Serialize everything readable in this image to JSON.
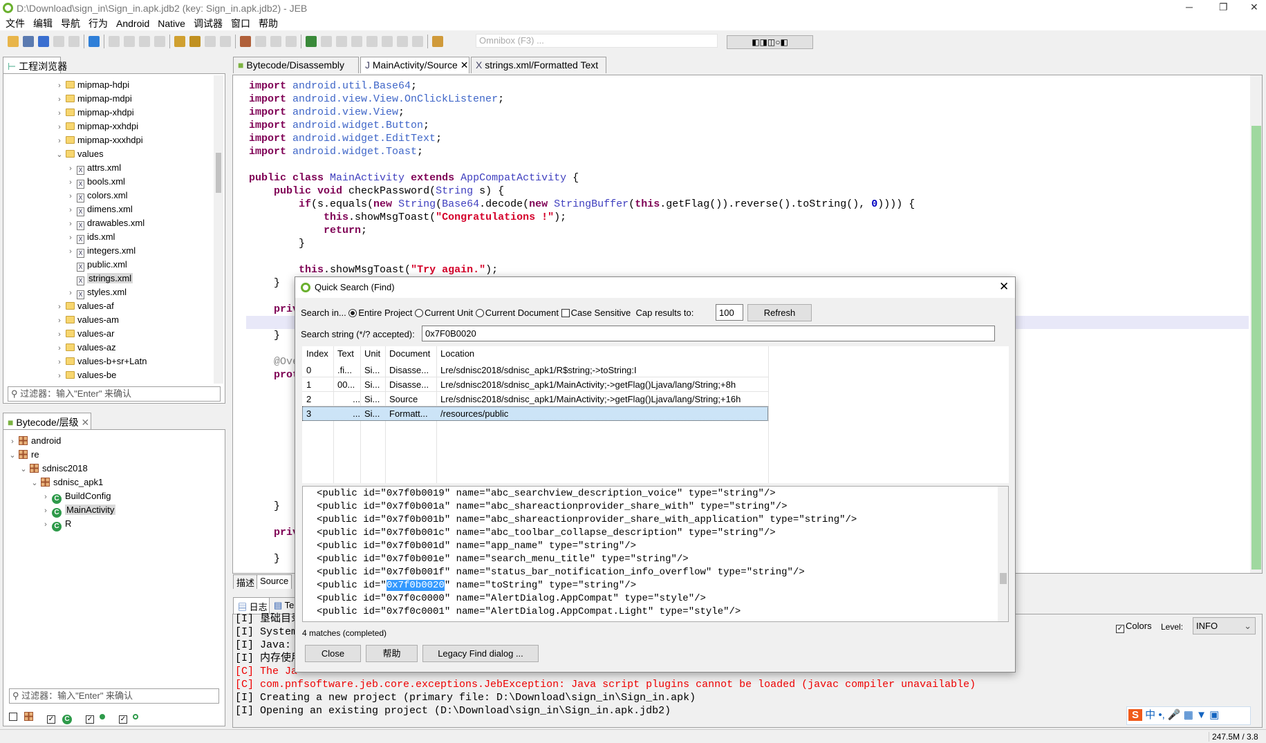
{
  "window": {
    "title": "D:\\Download\\sign_in\\Sign_in.apk.jdb2 (key: Sign_in.apk.jdb2) - JEB"
  },
  "menu": [
    "文件",
    "编辑",
    "导航",
    "行为",
    "Android",
    "Native",
    "调试器",
    "窗口",
    "帮助"
  ],
  "toolbar": {
    "icons": [
      "open-icon",
      "save-icon",
      "wrench-icon",
      "cube-icon",
      "warning-icon",
      "|",
      "globe-icon",
      "|",
      "jump-icon",
      "xref-icon",
      "back-icon",
      "forward-icon",
      "|",
      "decompile-icon",
      "comment-icon",
      "rename-icon",
      "export-icon",
      "|",
      "package-icon",
      "tree-icon",
      "nodes-icon",
      "graph-icon",
      "|",
      "debug-icon",
      "run-icon",
      "pause-icon",
      "stop-icon",
      "step-into-icon",
      "step-over-icon",
      "step-out-icon",
      "run-to-icon",
      "|",
      "plugin-icon"
    ],
    "omnibox_placeholder": "Omnibox (F3) ..."
  },
  "project_explorer": {
    "tab": "工程浏览器",
    "filter_placeholder": "过滤器：输入\"Enter\" 来确认",
    "items": [
      {
        "label": "mipmap-hdpi",
        "level": 0,
        "type": "folder",
        "state": "collapsed"
      },
      {
        "label": "mipmap-mdpi",
        "level": 0,
        "type": "folder",
        "state": "collapsed"
      },
      {
        "label": "mipmap-xhdpi",
        "level": 0,
        "type": "folder",
        "state": "collapsed"
      },
      {
        "label": "mipmap-xxhdpi",
        "level": 0,
        "type": "folder",
        "state": "collapsed"
      },
      {
        "label": "mipmap-xxxhdpi",
        "level": 0,
        "type": "folder",
        "state": "collapsed"
      },
      {
        "label": "values",
        "level": 0,
        "type": "folder",
        "state": "expanded"
      },
      {
        "label": "attrs.xml",
        "level": 1,
        "type": "xml",
        "state": "collapsed"
      },
      {
        "label": "bools.xml",
        "level": 1,
        "type": "xml",
        "state": "collapsed"
      },
      {
        "label": "colors.xml",
        "level": 1,
        "type": "xml",
        "state": "collapsed"
      },
      {
        "label": "dimens.xml",
        "level": 1,
        "type": "xml",
        "state": "collapsed"
      },
      {
        "label": "drawables.xml",
        "level": 1,
        "type": "xml",
        "state": "collapsed"
      },
      {
        "label": "ids.xml",
        "level": 1,
        "type": "xml",
        "state": "collapsed"
      },
      {
        "label": "integers.xml",
        "level": 1,
        "type": "xml",
        "state": "collapsed"
      },
      {
        "label": "public.xml",
        "level": 1,
        "type": "xml",
        "state": "leaf"
      },
      {
        "label": "strings.xml",
        "level": 1,
        "type": "xml",
        "state": "leaf",
        "selected": true
      },
      {
        "label": "styles.xml",
        "level": 1,
        "type": "xml",
        "state": "collapsed"
      },
      {
        "label": "values-af",
        "level": 0,
        "type": "folder",
        "state": "collapsed"
      },
      {
        "label": "values-am",
        "level": 0,
        "type": "folder",
        "state": "collapsed"
      },
      {
        "label": "values-ar",
        "level": 0,
        "type": "folder",
        "state": "collapsed"
      },
      {
        "label": "values-az",
        "level": 0,
        "type": "folder",
        "state": "collapsed"
      },
      {
        "label": "values-b+sr+Latn",
        "level": 0,
        "type": "folder",
        "state": "collapsed"
      },
      {
        "label": "values-be",
        "level": 0,
        "type": "folder",
        "state": "collapsed"
      }
    ]
  },
  "hierarchy": {
    "tab": "Bytecode/层级",
    "filter_placeholder": "过滤器：输入\"Enter\" 来确认",
    "items": [
      {
        "label": "android",
        "level": 0,
        "type": "package",
        "state": "collapsed"
      },
      {
        "label": "re",
        "level": 0,
        "type": "package",
        "state": "expanded"
      },
      {
        "label": "sdnisc2018",
        "level": 1,
        "type": "package",
        "state": "expanded"
      },
      {
        "label": "sdnisc_apk1",
        "level": 2,
        "type": "package",
        "state": "expanded"
      },
      {
        "label": "BuildConfig",
        "level": 3,
        "type": "class",
        "state": "collapsed"
      },
      {
        "label": "MainActivity",
        "level": 3,
        "type": "class",
        "state": "collapsed",
        "selected": true
      },
      {
        "label": "R",
        "level": 3,
        "type": "class",
        "state": "collapsed"
      }
    ],
    "toggles": [
      false,
      true,
      true,
      true
    ]
  },
  "editor": {
    "tabs": [
      {
        "label": "Bytecode/Disassembly",
        "active": false
      },
      {
        "label": "MainActivity/Source",
        "active": true
      },
      {
        "label": "strings.xml/Formatted Text",
        "active": false
      }
    ],
    "bottom_tabs": [
      "描述",
      "Source"
    ],
    "highlight_line": 19,
    "lines": [
      [
        [
          "kw",
          "import "
        ],
        [
          "pk",
          "android.util.Base64"
        ],
        [
          "",
          "; "
        ]
      ],
      [
        [
          "kw",
          "import "
        ],
        [
          "pk",
          "android.view.View.OnClickListener"
        ],
        [
          "",
          ";"
        ]
      ],
      [
        [
          "kw",
          "import "
        ],
        [
          "pk",
          "android.view.View"
        ],
        [
          "",
          ";"
        ]
      ],
      [
        [
          "kw",
          "import "
        ],
        [
          "pk",
          "android.widget.Button"
        ],
        [
          "",
          ";"
        ]
      ],
      [
        [
          "kw",
          "import "
        ],
        [
          "pk",
          "android.widget.EditText"
        ],
        [
          "",
          ";"
        ]
      ],
      [
        [
          "kw",
          "import "
        ],
        [
          "pk",
          "android.widget.Toast"
        ],
        [
          "",
          ";"
        ]
      ],
      [],
      [
        [
          "kw",
          "public class "
        ],
        [
          "ty",
          "MainActivity "
        ],
        [
          "kw",
          "extends "
        ],
        [
          "ty",
          "AppCompatActivity"
        ],
        [
          "",
          " {"
        ]
      ],
      [
        [
          "",
          "    "
        ],
        [
          "kw",
          "public void "
        ],
        [
          "",
          "checkPassword("
        ],
        [
          "ty",
          "String"
        ],
        [
          "",
          " s) {"
        ]
      ],
      [
        [
          "",
          "        "
        ],
        [
          "kw",
          "if"
        ],
        [
          "",
          "(s.equals("
        ],
        [
          "kw",
          "new "
        ],
        [
          "ty",
          "String"
        ],
        [
          "",
          "("
        ],
        [
          "ty",
          "Base64"
        ],
        [
          "",
          ".decode("
        ],
        [
          "kw",
          "new "
        ],
        [
          "ty",
          "StringBuffer"
        ],
        [
          "",
          "("
        ],
        [
          "kw",
          "this"
        ],
        [
          "",
          ".getFlag()).reverse().toString(), "
        ],
        [
          "nm",
          "0"
        ],
        [
          "",
          "))))"
        ],
        [
          "",
          " {"
        ]
      ],
      [
        [
          "",
          "            "
        ],
        [
          "kw",
          "this"
        ],
        [
          "",
          ".showMsgToast("
        ],
        [
          "st",
          "\"Congratulations !\""
        ],
        [
          "",
          ");"
        ]
      ],
      [
        [
          "",
          "            "
        ],
        [
          "kw",
          "return"
        ],
        [
          "",
          ";"
        ]
      ],
      [
        [
          "",
          "        }"
        ]
      ],
      [],
      [
        [
          "",
          "        "
        ],
        [
          "kw",
          "this"
        ],
        [
          "",
          ".showMsgToast("
        ],
        [
          "st",
          "\"Try again.\""
        ],
        [
          "",
          ");"
        ]
      ],
      [
        [
          "",
          "    }"
        ]
      ],
      [],
      [
        [
          "",
          "    "
        ],
        [
          "kw",
          "priv"
        ]
      ],
      [],
      [
        [
          "",
          "    }"
        ]
      ],
      [],
      [
        [
          "",
          "    "
        ],
        [
          "an",
          "@Ove"
        ]
      ],
      [
        [
          "",
          "    "
        ],
        [
          "kw",
          "prot"
        ]
      ],
      [],
      [],
      [],
      [],
      [],
      [],
      [],
      [],
      [],
      [
        [
          "",
          "    }"
        ]
      ],
      [],
      [
        [
          "",
          "    "
        ],
        [
          "kw",
          "priv"
        ]
      ],
      [],
      [
        [
          "",
          "    }"
        ]
      ],
      [
        [
          "",
          "}"
        ]
      ]
    ]
  },
  "log": {
    "tabs": [
      "日志",
      "Te"
    ],
    "colors_label": "Colors",
    "colors_checked": true,
    "level_label": "Level:",
    "level_value": "INFO",
    "lines": [
      {
        "kind": "info",
        "text": "[I] 垦础目录"
      },
      {
        "kind": "info",
        "text": "[I] System"
      },
      {
        "kind": "info",
        "text": "[I] Java: "
      },
      {
        "kind": "info",
        "text": "[I] 内存使用"
      },
      {
        "kind": "err",
        "text": "[C] The Ja"
      },
      {
        "kind": "err",
        "text": "[C] com.pnfsoftware.jeb.core.exceptions.JebException: Java script plugins cannot be loaded (javac compiler unavailable)"
      },
      {
        "kind": "info",
        "text": "[I] Creating a new project (primary file: D:\\Download\\sign_in\\Sign_in.apk)"
      },
      {
        "kind": "info",
        "text": "[I] Opening an existing project (D:\\Download\\sign_in\\Sign_in.apk.jdb2)"
      }
    ]
  },
  "status": {
    "memory": "247.5M / 3.8"
  },
  "dialog": {
    "title": "Quick Search (Find)",
    "search_in_label": "Search in...",
    "scopes": [
      {
        "label": "Entire Project",
        "checked": true
      },
      {
        "label": "Current Unit",
        "checked": false
      },
      {
        "label": "Current Document",
        "checked": false
      }
    ],
    "case_sensitive_label": "Case Sensitive",
    "case_sensitive": false,
    "cap_label": "Cap results to:",
    "cap_value": "100",
    "refresh_label": "Refresh",
    "search_label": "Search string (*/? accepted):",
    "search_value": "0x7F0B0020",
    "columns": [
      "Index",
      "Text",
      "Unit",
      "Document",
      "Location"
    ],
    "rows": [
      [
        "0",
        ".fi...",
        "Si...",
        "Disasse...",
        "Lre/sdnisc2018/sdnisc_apk1/R$string;->toString:I"
      ],
      [
        "1",
        "00...",
        "Si...",
        "Disasse...",
        "Lre/sdnisc2018/sdnisc_apk1/MainActivity;->getFlag()Ljava/lang/String;+8h"
      ],
      [
        "2",
        "...",
        "Si...",
        "Source",
        "Lre/sdnisc2018/sdnisc_apk1/MainActivity;->getFlag()Ljava/lang/String;+16h"
      ],
      [
        "3",
        "...",
        "Si...",
        "Formatt...",
        "/resources/public"
      ]
    ],
    "selected_row": 3,
    "preview": [
      [
        "<public id=\"0x7f0b0019\" name=\"abc_searchview_description_voice\" type=\"string\"/>"
      ],
      [
        "<public id=\"0x7f0b001a\" name=\"abc_shareactionprovider_share_with\" type=\"string\"/>"
      ],
      [
        "<public id=\"0x7f0b001b\" name=\"abc_shareactionprovider_share_with_application\" type=\"string\"/>"
      ],
      [
        "<public id=\"0x7f0b001c\" name=\"abc_toolbar_collapse_description\" type=\"string\"/>"
      ],
      [
        "<public id=\"0x7f0b001d\" name=\"app_name\" type=\"string\"/>"
      ],
      [
        "<public id=\"0x7f0b001e\" name=\"search_menu_title\" type=\"string\"/>"
      ],
      [
        "<public id=\"0x7f0b001f\" name=\"status_bar_notification_info_overflow\" type=\"string\"/>"
      ],
      [
        "<public id=\"",
        "0x7f0b0020",
        "\" name=\"toString\" type=\"string\"/>"
      ],
      [
        "<public id=\"0x7f0c0000\" name=\"AlertDialog.AppCompat\" type=\"style\"/>"
      ],
      [
        "<public id=\"0x7f0c0001\" name=\"AlertDialog.AppCompat.Light\" type=\"style\"/>"
      ]
    ],
    "status": "4 matches (completed)",
    "close_label": "Close",
    "help_label": "帮助",
    "legacy_label": "Legacy Find dialog ..."
  }
}
